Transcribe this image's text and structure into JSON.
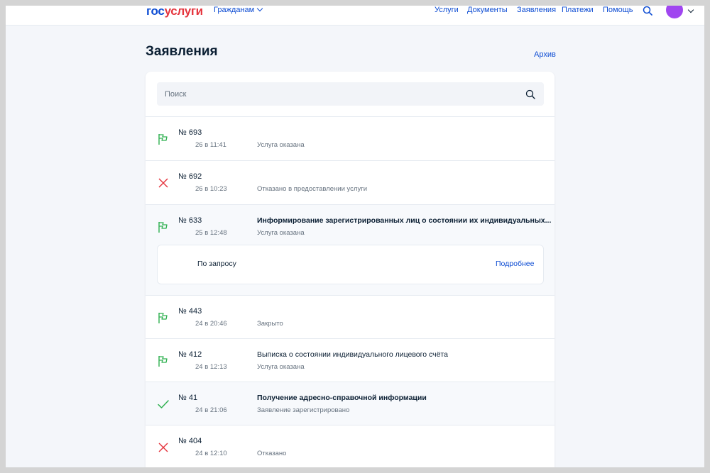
{
  "header": {
    "logo_gos": "гос",
    "logo_uslugi": "услуги",
    "audience": "Гражданам",
    "nav": [
      "Услуги",
      "Документы",
      "Заявления",
      "Платежи",
      "Помощь"
    ],
    "avatar_color": "#a046f0"
  },
  "page": {
    "title": "Заявления",
    "archive": "Архив"
  },
  "search": {
    "placeholder": "Поиск"
  },
  "subcard": {
    "label": "По запросу",
    "link": "Подробнее"
  },
  "applications": [
    {
      "icon": "flag-icon",
      "number": "№ 693",
      "date": "26 в 11:41",
      "title": "",
      "status": "Услуга оказана"
    },
    {
      "icon": "cross-icon",
      "number": "№ 692",
      "date": "26 в 10:23",
      "title": "",
      "status": "Отказано в предоставлении услуги"
    },
    {
      "icon": "flag-icon",
      "number": "№ 633",
      "date": "25 в 12:48",
      "title": "Информирование зарегистрированных лиц о состоянии их индивидуальных...",
      "status": "Услуга оказана"
    },
    {
      "icon": "flag-icon",
      "number": "№ 443",
      "date": "24 в 20:46",
      "title": "",
      "status": "Закрыто"
    },
    {
      "icon": "flag-icon",
      "number": "№ 412",
      "date": "24 в 12:13",
      "title": "Выписка о состоянии индивидуального лицевого счёта",
      "status": "Услуга оказана"
    },
    {
      "icon": "check-icon",
      "number": "№ 41",
      "date": "24 в 21:06",
      "title": "Получение адресно-справочной информации",
      "status": "Заявление зарегистрировано"
    },
    {
      "icon": "cross-icon",
      "number": "№ 404",
      "date": "24 в 12:10",
      "title": "",
      "status": "Отказано"
    }
  ],
  "colors": {
    "accent": "#0d4cd3",
    "success": "#2eb04f",
    "error": "#e5343d",
    "brand_red": "#e5343d"
  }
}
